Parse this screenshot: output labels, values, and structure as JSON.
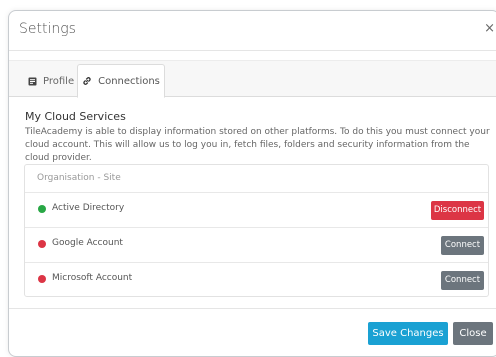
{
  "modal": {
    "title": "Settings",
    "close_glyph": "×"
  },
  "tabs": [
    {
      "label": "Profile",
      "icon": "id-card-icon",
      "active": false
    },
    {
      "label": "Connections",
      "icon": "link-icon",
      "active": true
    }
  ],
  "cloud": {
    "title": "My Cloud Services",
    "description": "TileAcademy is able to display information stored on other platforms. To do this you must connect your cloud account. This will allow us to log you in, fetch files, folders and security information from the cloud provider.",
    "table_header": "Organisation - Site",
    "services": [
      {
        "name": "Active Directory",
        "status_color": "#28a745",
        "action": "Disconnect",
        "action_color": "#dc3545"
      },
      {
        "name": "Google Account",
        "status_color": "#dc3545",
        "action": "Connect",
        "action_color": "#6c757d"
      },
      {
        "name": "Microsoft Account",
        "status_color": "#dc3545",
        "action": "Connect",
        "action_color": "#6c757d"
      }
    ]
  },
  "footer": {
    "save_label": "Save Changes",
    "close_label": "Close",
    "save_color": "#1aa1d3",
    "close_color": "#6c757d"
  }
}
